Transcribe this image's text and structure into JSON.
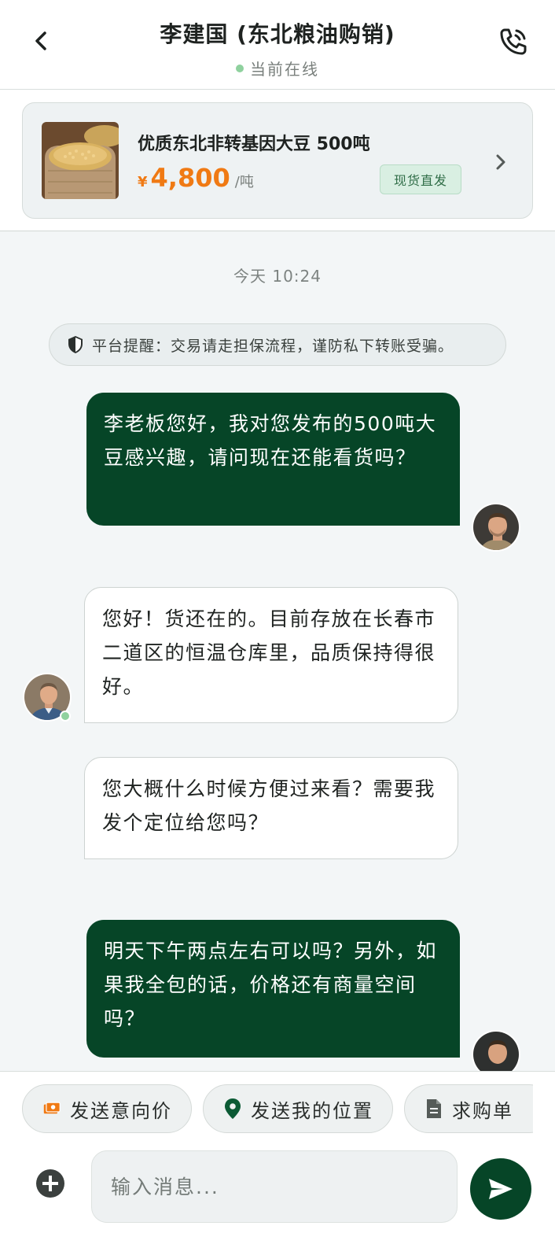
{
  "header": {
    "contact_name": "李建国 (东北粮油购销)",
    "status": "当前在线"
  },
  "product": {
    "title": "优质东北非转基因大豆 500吨",
    "price_symbol": "¥",
    "price": "4,800",
    "unit": "/吨",
    "badge": "现货直发"
  },
  "chat": {
    "timestamp": "今天 10:24",
    "notice": "平台提醒：交易请走担保流程，谨防私下转账受骗。",
    "messages": [
      {
        "direction": "out",
        "text": "李老板您好，我对您发布的500吨大豆感兴趣，请问现在还能看货吗？"
      },
      {
        "direction": "in",
        "text": "您好！货还在的。目前存放在长春市二道区的恒温仓库里，品质保持得很好。"
      },
      {
        "direction": "in",
        "text": "您大概什么时候方便过来看？需要我发个定位给您吗？"
      },
      {
        "direction": "out",
        "text": "明天下午两点左右可以吗？另外，如果我全包的话，价格还有商量空间吗？"
      }
    ]
  },
  "quick_actions": [
    {
      "label": "发送意向价",
      "icon": "money-icon"
    },
    {
      "label": "发送我的位置",
      "icon": "location-pin-icon"
    },
    {
      "label": "求购单",
      "icon": "document-icon"
    }
  ],
  "composer": {
    "placeholder": "输入消息..."
  },
  "colors": {
    "primary": "#064527",
    "accent_price": "#f07a14",
    "online": "#8fd19e",
    "background": "#f3f6f7"
  }
}
